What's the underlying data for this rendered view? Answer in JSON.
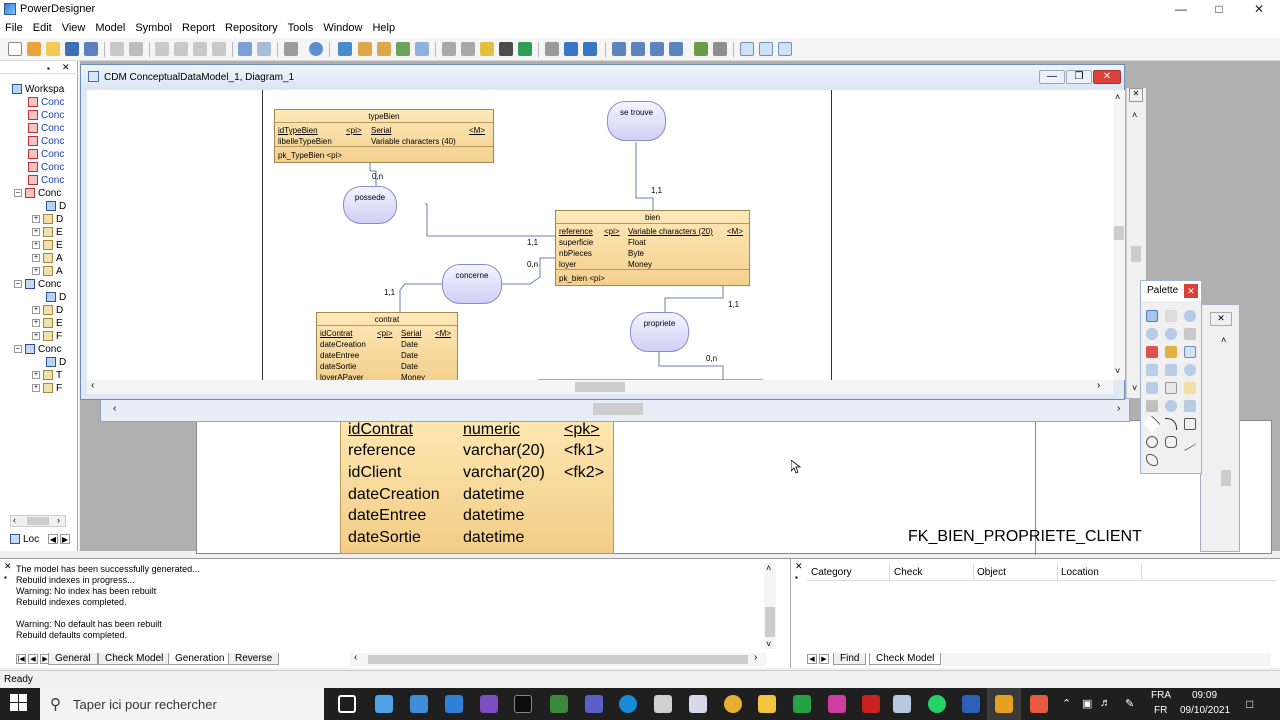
{
  "app": {
    "title": "PowerDesigner"
  },
  "menu": [
    "File",
    "Edit",
    "View",
    "Model",
    "Symbol",
    "Report",
    "Repository",
    "Tools",
    "Window",
    "Help"
  ],
  "browser": {
    "items": [
      "Workspa",
      "Conc",
      "Conc",
      "Conc",
      "Conc",
      "Conc",
      "Conc",
      "Conc",
      "Conc",
      "D",
      "D",
      "E",
      "E",
      "A",
      "A",
      "Conc",
      "D",
      "D",
      "E",
      "F",
      "Conc",
      "D",
      "T",
      "F"
    ],
    "bottom_tab": "Loc"
  },
  "diagram_window": {
    "title": "CDM ConceptualDataModel_1, Diagram_1"
  },
  "entities": {
    "typeBien": {
      "name": "typeBien",
      "rows": [
        [
          "idTypeBien",
          "<pi>",
          "Serial",
          "<M>"
        ],
        [
          "libelleTypeBien",
          "",
          "Variable characters (40)",
          ""
        ]
      ],
      "key": "pk_TypeBien   <pi>"
    },
    "bien": {
      "name": "bien",
      "rows": [
        [
          "reference",
          "<pi>",
          "Variable characters (20)",
          "<M>"
        ],
        [
          "superficie",
          "",
          "Float",
          ""
        ],
        [
          "nbPieces",
          "",
          "Byte",
          ""
        ],
        [
          "loyer",
          "",
          "Money",
          ""
        ]
      ],
      "key": "pk_bien   <pi>"
    },
    "contrat": {
      "name": "contrat",
      "rows": [
        [
          "idContrat",
          "<pi>",
          "Serial",
          "<M>"
        ],
        [
          "dateCreation",
          "",
          "Date",
          ""
        ],
        [
          "dateEntree",
          "",
          "Date",
          ""
        ],
        [
          "dateSortie",
          "",
          "Date",
          ""
        ],
        [
          "loyerAPayer",
          "",
          "Money",
          ""
        ]
      ]
    }
  },
  "associations": [
    "se trouve",
    "possede",
    "concerne",
    "propriete"
  ],
  "cardinalities": [
    "0,n",
    "1,1",
    "1,1",
    "0,n",
    "1,1",
    "1,1",
    "0,n"
  ],
  "pdm_table": {
    "rows": [
      [
        "idContrat",
        "numeric",
        "<pk>"
      ],
      [
        "reference",
        "varchar(20)",
        "<fk1>"
      ],
      [
        "idClient",
        "varchar(20)",
        "<fk2>"
      ],
      [
        "dateCreation",
        "datetime",
        ""
      ],
      [
        "dateEntree",
        "datetime",
        ""
      ],
      [
        "dateSortie",
        "datetime",
        ""
      ]
    ],
    "fk_label": "FK_BIEN_PROPRIETE_CLIENT"
  },
  "palette": {
    "title": "Palette"
  },
  "output": {
    "lines": [
      "The model has been successfully generated...",
      "Rebuild indexes in progress...",
      "Warning: No index has been rebuilt",
      "Rebuild indexes completed.",
      "",
      "Warning: No default has been rebuilt",
      "Rebuild defaults completed."
    ],
    "tabs": [
      "General",
      "Check Model",
      "Generation",
      "Reverse"
    ],
    "active_tab": "Generation"
  },
  "results": {
    "columns": [
      "Category",
      "Check",
      "Object",
      "Location"
    ],
    "tabs": [
      "Find",
      "Check Model"
    ]
  },
  "status": "Ready",
  "taskbar": {
    "search_placeholder": "Taper ici pour rechercher",
    "lang": "FRA",
    "lang2": "FR",
    "time": "09:09",
    "date": "09/10/2021"
  }
}
